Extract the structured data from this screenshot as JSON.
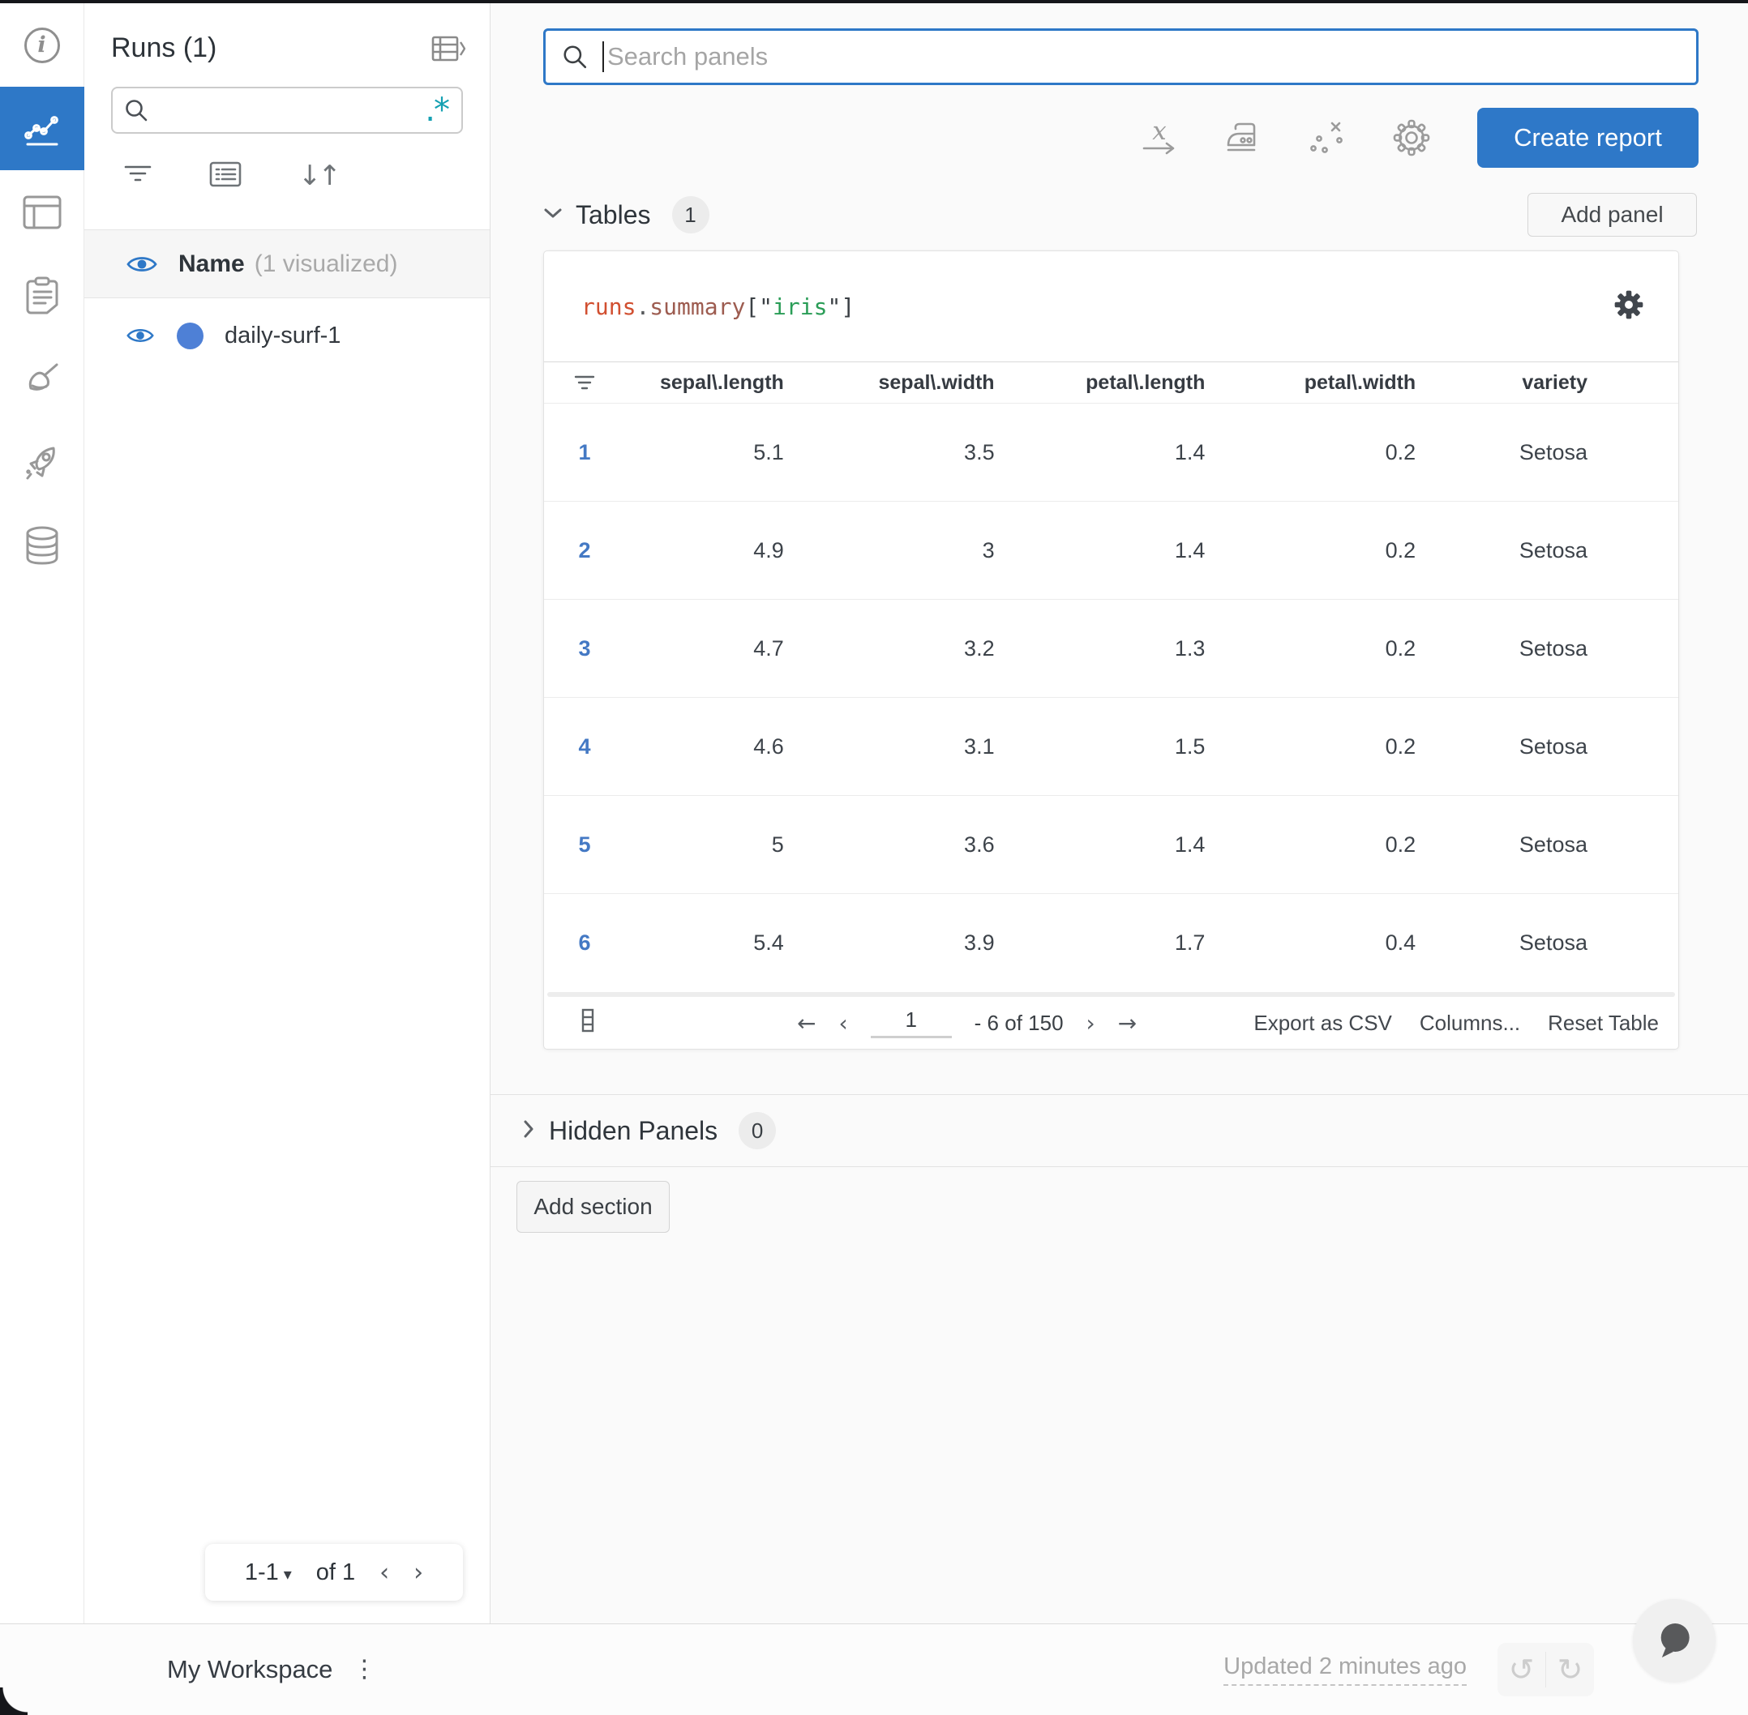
{
  "icon_rail": {
    "items": [
      {
        "name": "info-icon"
      },
      {
        "name": "workspace-chart-icon",
        "active": true
      },
      {
        "name": "panels-layout-icon"
      },
      {
        "name": "notes-clipboard-icon"
      },
      {
        "name": "sweeps-broom-icon"
      },
      {
        "name": "launch-rocket-icon"
      },
      {
        "name": "artifacts-database-icon"
      }
    ]
  },
  "runs_panel": {
    "title": "Runs (1)",
    "search": {
      "value": "",
      "regex_toggle_label": ".*"
    },
    "header_row": {
      "label": "Name",
      "annotation": "(1 visualized)"
    },
    "runs": [
      {
        "name": "daily-surf-1",
        "dot_color": "#4e80d6"
      }
    ],
    "pagination": {
      "range_label": "1-1",
      "of_label": "of 1",
      "prev": "‹",
      "next": "›"
    }
  },
  "panels_search": {
    "placeholder": "Search panels"
  },
  "toolbar": {
    "create_report_label": "Create report",
    "icons": [
      "x-axis-icon",
      "smoothing-iron-icon",
      "outliers-icon",
      "settings-gear-icon"
    ]
  },
  "sections": {
    "tables": {
      "label": "Tables",
      "count": "1",
      "add_panel_label": "Add panel"
    },
    "hidden_panels": {
      "label": "Hidden Panels",
      "count": "0"
    },
    "add_section_label": "Add section"
  },
  "table_panel": {
    "title": {
      "obj": "runs",
      "dot": ".",
      "attr": "summary",
      "open": "[",
      "q1": "\"",
      "key": "iris",
      "q2": "\"",
      "close": "]"
    },
    "columns": [
      "sepal\\.length",
      "sepal\\.width",
      "petal\\.length",
      "petal\\.width",
      "variety"
    ],
    "rows": [
      {
        "index": "1",
        "values": [
          "5.1",
          "3.5",
          "1.4",
          "0.2",
          "Setosa"
        ]
      },
      {
        "index": "2",
        "values": [
          "4.9",
          "3",
          "1.4",
          "0.2",
          "Setosa"
        ]
      },
      {
        "index": "3",
        "values": [
          "4.7",
          "3.2",
          "1.3",
          "0.2",
          "Setosa"
        ]
      },
      {
        "index": "4",
        "values": [
          "4.6",
          "3.1",
          "1.5",
          "0.2",
          "Setosa"
        ]
      },
      {
        "index": "5",
        "values": [
          "5",
          "3.6",
          "1.4",
          "0.2",
          "Setosa"
        ]
      },
      {
        "index": "6",
        "values": [
          "5.4",
          "3.9",
          "1.7",
          "0.4",
          "Setosa"
        ]
      }
    ],
    "footer": {
      "page_value": "1",
      "range_label": "- 6 of 150",
      "prev_page": "‹",
      "next_page": "›",
      "first_page": "←",
      "last_page": "→",
      "export_label": "Export as CSV",
      "columns_label": "Columns...",
      "reset_label": "Reset Table"
    }
  },
  "status_bar": {
    "workspace_label": "My Workspace",
    "kebab_glyph": "⋮",
    "updated_label": "Updated 2 minutes ago",
    "undo_glyph": "↺",
    "redo_glyph": "↻"
  },
  "colors": {
    "accent_blue": "#2e78c7",
    "run_dot_blue": "#4e80d6",
    "regex_teal": "#14a0b2",
    "code_object": "#d14f30",
    "code_attribute": "#9d5c50",
    "code_string": "#2a9d57",
    "code_punctuation": "#3b4045"
  }
}
